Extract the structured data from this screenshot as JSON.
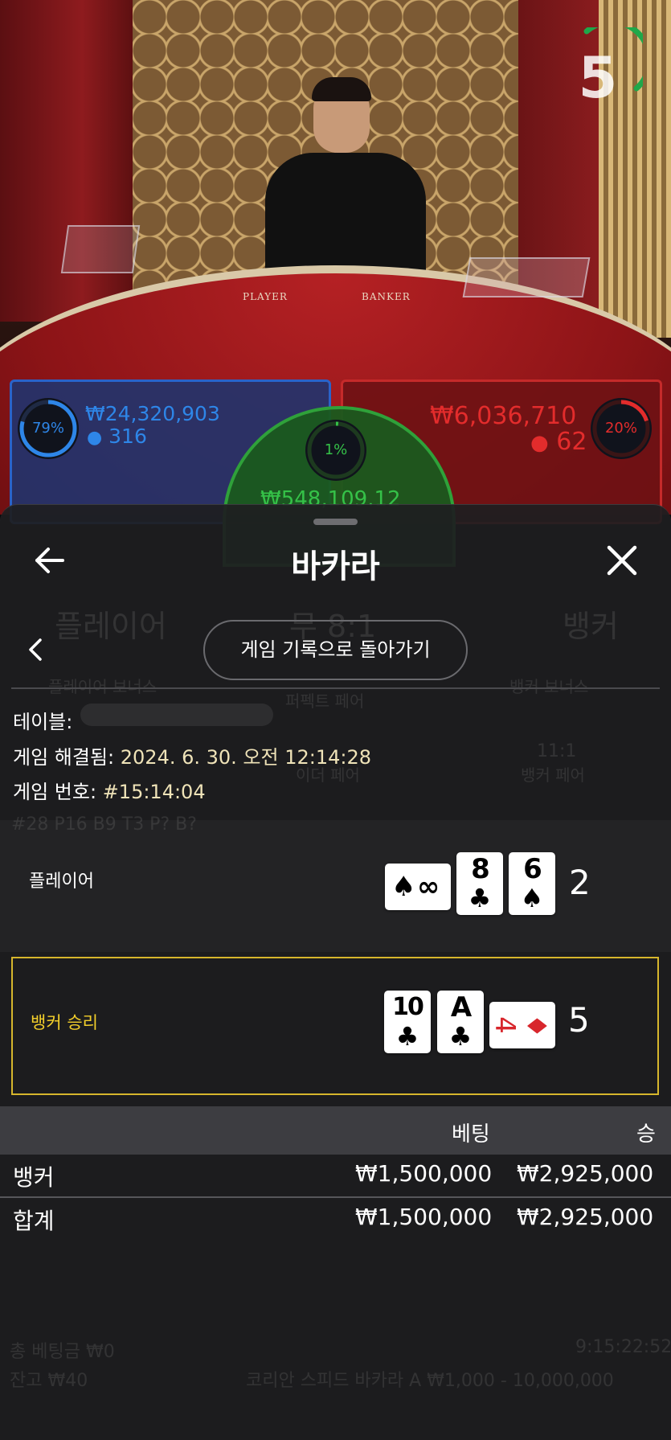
{
  "video": {
    "timer_value": "5",
    "table_label_player": "PLAYER",
    "table_label_banker": "BANKER"
  },
  "betting_spots": {
    "player": {
      "percent": "79%",
      "amount": "₩24,320,903",
      "players": "316",
      "color": "#2e86e8"
    },
    "tie": {
      "percent": "1%",
      "amount": "₩548,109.12",
      "color": "#35c148"
    },
    "banker": {
      "percent": "20%",
      "amount": "₩6,036,710",
      "players": "62",
      "color": "#e32c2c"
    }
  },
  "sheet": {
    "title": "바카라",
    "back_to_history": "게임 기록으로 돌아가기",
    "info": {
      "table_label": "테이블:",
      "resolved_label": "게임 해결됨:",
      "resolved_value": "2024. 6. 30. 오전 12:14:28",
      "game_no_label": "게임 번호:",
      "game_no_value": "#15:14:04"
    },
    "player_row": {
      "label": "플레이어",
      "cards": [
        {
          "rank": "8",
          "suit": "♣"
        },
        {
          "rank": "6",
          "suit": "♠"
        }
      ],
      "side_card": {
        "rank": "∞",
        "suit": "♠"
      },
      "score": "2"
    },
    "banker_row": {
      "label": "뱅커 승리",
      "cards": [
        {
          "rank": "10",
          "suit": "♣"
        },
        {
          "rank": "A",
          "suit": "♣"
        }
      ],
      "side_card": {
        "rank": "♦",
        "suit": "4"
      },
      "score": "5",
      "highlight_color": "#d6b62c"
    },
    "bets": {
      "headers": {
        "bet": "베팅",
        "win": "승"
      },
      "rows": [
        {
          "name": "뱅커",
          "bet": "₩1,500,000",
          "win": "₩2,925,000"
        }
      ],
      "total": {
        "name": "합계",
        "bet": "₩1,500,000",
        "win": "₩2,925,000"
      }
    }
  },
  "background_ghost": {
    "player_tab": "플레이어",
    "tie_tab": "무 8:1",
    "banker_tab": "뱅커",
    "player_bonus": "플레이어 보너스",
    "banker_bonus": "뱅커 보너스",
    "perfect_pair": "퍼펙트 페어",
    "either_pair": "이더 페어",
    "banker_pair_odds": "11:1",
    "banker_pair": "뱅커 페어",
    "footer_total": "총 베팅금 ₩0",
    "footer_balance": "잔고 ₩40",
    "footer_table": "코리안 스피드 바카라 A ₩1,000 - 10,000,000",
    "footer_time": "9:15:22:52"
  }
}
